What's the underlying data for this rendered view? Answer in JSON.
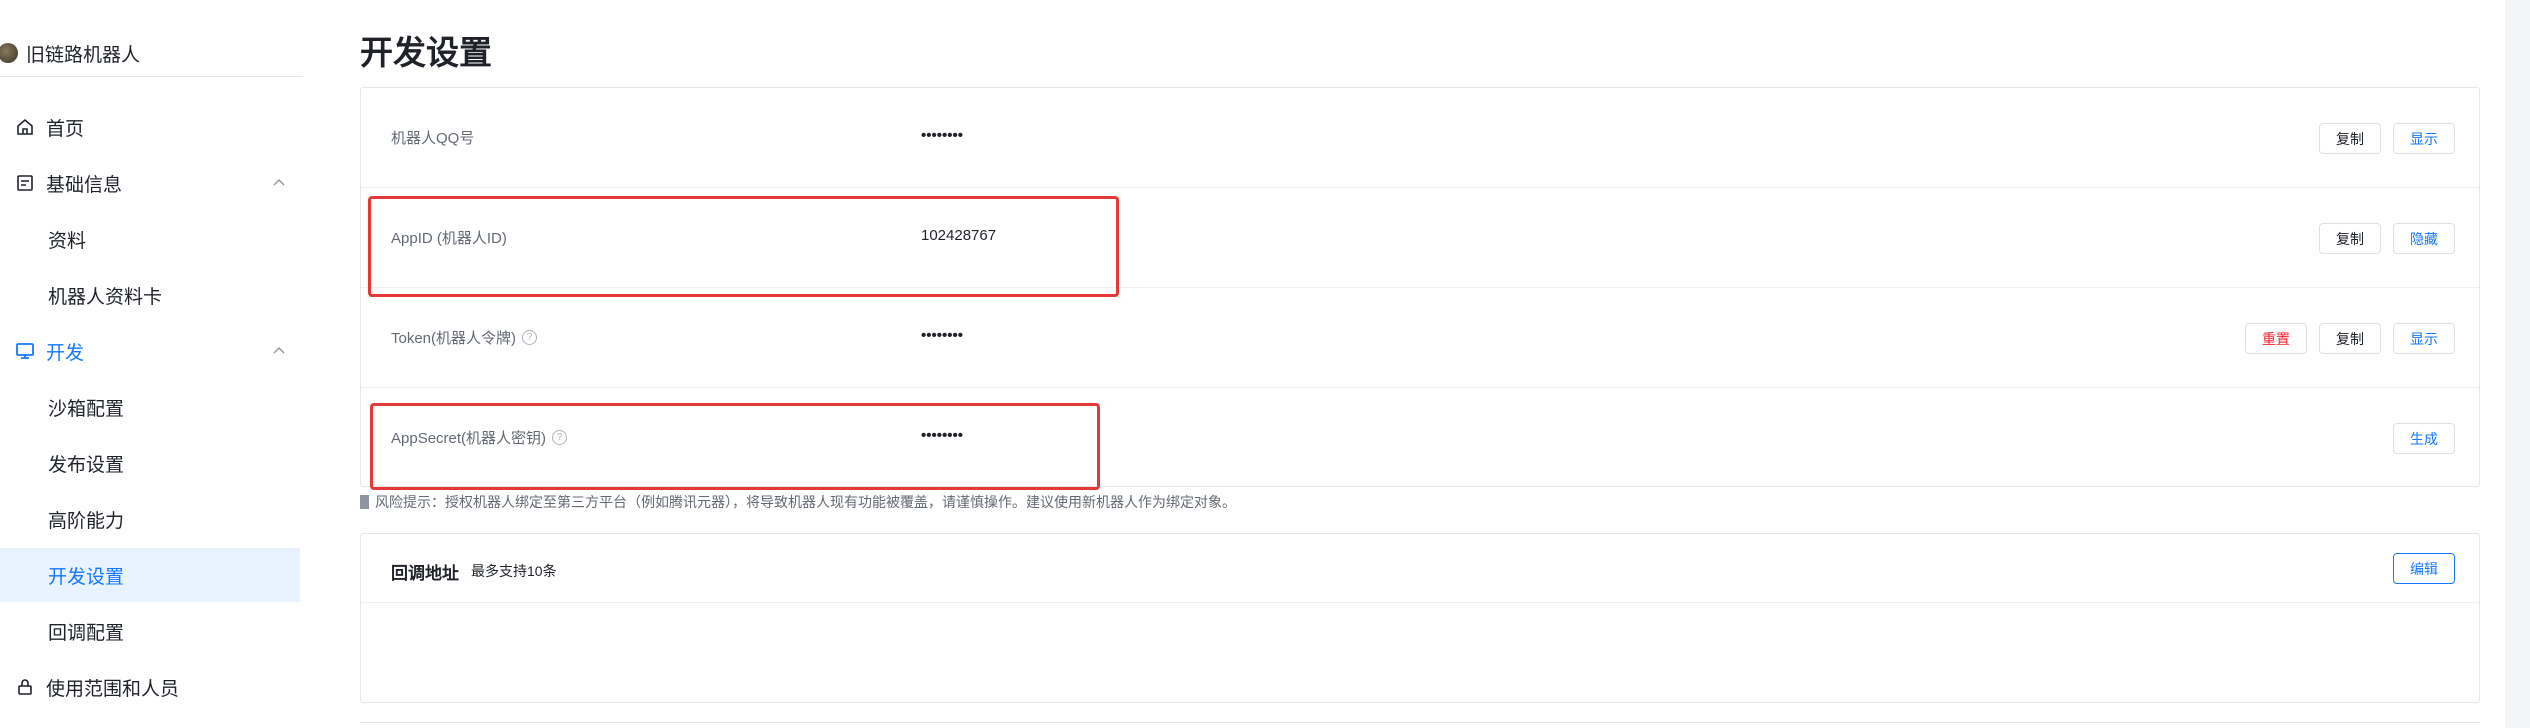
{
  "sidebar": {
    "bot_name": "旧链路机器人",
    "items": [
      {
        "label": "首页",
        "icon": "home-icon"
      },
      {
        "label": "基础信息",
        "icon": "document-icon"
      },
      {
        "label": "资料"
      },
      {
        "label": "机器人资料卡"
      },
      {
        "label": "开发",
        "icon": "monitor-icon"
      },
      {
        "label": "沙箱配置"
      },
      {
        "label": "发布设置"
      },
      {
        "label": "高阶能力"
      },
      {
        "label": "开发设置"
      },
      {
        "label": "回调配置"
      },
      {
        "label": "使用范围和人员",
        "icon": "lock-icon"
      }
    ]
  },
  "main": {
    "title": "开发设置",
    "rows": [
      {
        "label": "机器人QQ号",
        "value": "••••••••",
        "actions": [
          "复制",
          "显示"
        ]
      },
      {
        "label": "AppID (机器人ID)",
        "value": "102428767",
        "actions": [
          "复制",
          "隐藏"
        ]
      },
      {
        "label": "Token(机器人令牌)",
        "value": "••••••••",
        "actions": [
          "重置",
          "复制",
          "显示"
        ]
      },
      {
        "label": "AppSecret(机器人密钥)",
        "value": "••••••••",
        "actions": [
          "生成"
        ]
      }
    ],
    "risk_notice": "风险提示：授权机器人绑定至第三方平台（例如腾讯元器），将导致机器人现有功能被覆盖，请谨慎操作。建议使用新机器人作为绑定对象。",
    "callback": {
      "title": "回调地址",
      "subtitle": "最多支持10条",
      "edit_label": "编辑"
    }
  },
  "colors": {
    "accent": "#1677ff",
    "danger": "#f5222d",
    "highlight": "#e53935",
    "active_bg": "#e8f3ff"
  }
}
